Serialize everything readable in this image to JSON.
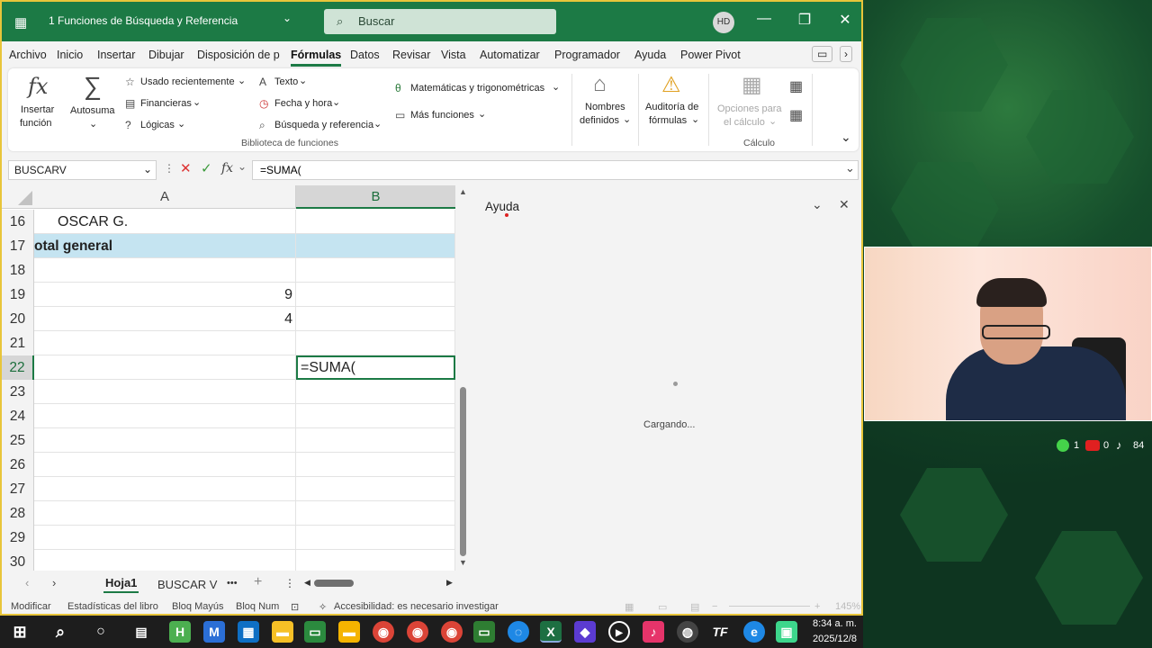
{
  "window": {
    "title": "1 Funciones de Búsqueda y Referencia",
    "search": "Buscar",
    "user": "HD",
    "min": "—",
    "restore": "❐",
    "close": "✕"
  },
  "menu": [
    "Archivo",
    "Inicio",
    "Insertar",
    "Dibujar",
    "Disposición de p",
    "Fórmulas",
    "Datos",
    "Revisar",
    "Vista",
    "Automatizar",
    "Programador",
    "Ayuda",
    "Power Pivot"
  ],
  "ribbon": {
    "insert_fn": [
      "Insertar",
      "función"
    ],
    "autosum": "Autosuma",
    "col1": [
      "Usado recientemente",
      "Financieras",
      "Lógicas"
    ],
    "col2": [
      "Texto",
      "Fecha y hora",
      "Búsqueda y referencia"
    ],
    "col3": [
      "Matemáticas y trigonométricas",
      "Más funciones"
    ],
    "group1": "Biblioteca de funciones",
    "names": [
      "Nombres",
      "definidos"
    ],
    "audit": [
      "Auditoría de",
      "fórmulas"
    ],
    "calcopts": [
      "Opciones para",
      "el cálculo"
    ],
    "group2": "Cálculo"
  },
  "formula": {
    "namebox": "BUSCARV",
    "fx": "fx",
    "value": "=SUMA("
  },
  "grid": {
    "cols": [
      "A",
      "B"
    ],
    "rows": [
      {
        "n": "16",
        "a": "OSCAR G.",
        "b": ""
      },
      {
        "n": "17",
        "a": "otal general",
        "b": ""
      },
      {
        "n": "18",
        "a": "",
        "b": ""
      },
      {
        "n": "19",
        "a": "9",
        "b": ""
      },
      {
        "n": "20",
        "a": "4",
        "b": ""
      },
      {
        "n": "21",
        "a": "",
        "b": ""
      },
      {
        "n": "22",
        "a": "",
        "b": "=SUMA("
      },
      {
        "n": "23",
        "a": "",
        "b": ""
      },
      {
        "n": "24",
        "a": "",
        "b": ""
      },
      {
        "n": "25",
        "a": "",
        "b": ""
      },
      {
        "n": "26",
        "a": "",
        "b": ""
      },
      {
        "n": "27",
        "a": "",
        "b": ""
      },
      {
        "n": "28",
        "a": "",
        "b": ""
      },
      {
        "n": "29",
        "a": "",
        "b": ""
      },
      {
        "n": "30",
        "a": "",
        "b": ""
      }
    ]
  },
  "help": {
    "title": "Ayuda",
    "loading": "Cargando..."
  },
  "sheets": {
    "active": "Hoja1",
    "other": "BUSCAR V",
    "more": "•••",
    "add": "+",
    "opts": "⋮"
  },
  "status": {
    "mode": "Modificar",
    "stats": "Estadísticas del libro",
    "caps": "Bloq Mayús",
    "num": "Bloq Num",
    "access": "Accesibilidad: es necesario investigar",
    "zoom": "145%"
  },
  "clock": {
    "time": "8:34 a. m.",
    "date": "2025/12/8"
  },
  "social": {
    "a": "1",
    "b": "0",
    "c": "84"
  },
  "colors": {
    "accent": "#1c7a45",
    "selection": "#c5e4f1"
  }
}
